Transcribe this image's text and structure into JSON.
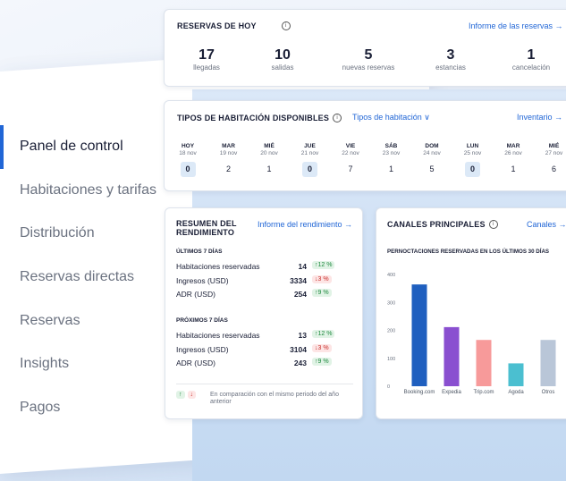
{
  "sidebar": {
    "items": [
      {
        "label": "Panel de control",
        "active": true
      },
      {
        "label": "Habitaciones y tarifas",
        "active": false
      },
      {
        "label": "Distribución",
        "active": false
      },
      {
        "label": "Reservas directas",
        "active": false
      },
      {
        "label": "Reservas",
        "active": false
      },
      {
        "label": "Insights",
        "active": false
      },
      {
        "label": "Pagos",
        "active": false
      }
    ]
  },
  "today": {
    "title": "RESERVAS DE HOY",
    "info_icon": "i",
    "link": "Informe de las reservas →",
    "stats": [
      {
        "value": "17",
        "label": "llegadas"
      },
      {
        "value": "10",
        "label": "salidas"
      },
      {
        "value": "5",
        "label": "nuevas reservas"
      },
      {
        "value": "3",
        "label": "estancias"
      },
      {
        "value": "1",
        "label": "cancelación"
      }
    ]
  },
  "rooms": {
    "title": "TIPOS DE HABITACIÓN DISPONIBLES",
    "info_icon": "i",
    "filter": "Tipos de habitación ∨",
    "link": "Inventario →",
    "days": [
      {
        "day": "HOY",
        "date": "18 nov",
        "value": "0",
        "zero": true
      },
      {
        "day": "MAR",
        "date": "19 nov",
        "value": "2",
        "zero": false
      },
      {
        "day": "MIÉ",
        "date": "20 nov",
        "value": "1",
        "zero": false
      },
      {
        "day": "JUE",
        "date": "21 nov",
        "value": "0",
        "zero": true
      },
      {
        "day": "VIE",
        "date": "22 nov",
        "value": "7",
        "zero": false
      },
      {
        "day": "SÁB",
        "date": "23 nov",
        "value": "1",
        "zero": false
      },
      {
        "day": "DOM",
        "date": "24 nov",
        "value": "5",
        "zero": false
      },
      {
        "day": "LUN",
        "date": "25 nov",
        "value": "0",
        "zero": true
      },
      {
        "day": "MAR",
        "date": "26 nov",
        "value": "1",
        "zero": false
      },
      {
        "day": "MIÉ",
        "date": "27 nov",
        "value": "6",
        "zero": false
      }
    ]
  },
  "performance": {
    "title": "RESUMEN DEL RENDIMIENTO",
    "link": "Informe del rendimiento →",
    "last7_label": "ÚLTIMOS 7 DÍAS",
    "last7": [
      {
        "label": "Habitaciones reservadas",
        "value": "14",
        "delta": "↑12 %",
        "dir": "up"
      },
      {
        "label": "Ingresos (USD)",
        "value": "3334",
        "delta": "↓3 %",
        "dir": "down"
      },
      {
        "label": "ADR (USD)",
        "value": "254",
        "delta": "↑9 %",
        "dir": "up"
      }
    ],
    "next7_label": "PRÓXIMOS 7 DÍAS",
    "next7": [
      {
        "label": "Habitaciones reservadas",
        "value": "13",
        "delta": "↑12 %",
        "dir": "up"
      },
      {
        "label": "Ingresos (USD)",
        "value": "3104",
        "delta": "↓3 %",
        "dir": "down"
      },
      {
        "label": "ADR (USD)",
        "value": "243",
        "delta": "↑9 %",
        "dir": "up"
      }
    ],
    "footnote": "En comparación con el mismo periodo del año anterior",
    "legend_up": "↑",
    "legend_down": "↓",
    "colors": {
      "up": "#1f8a3f",
      "down": "#c9302c"
    }
  },
  "channels": {
    "title": "CANALES PRINCIPALES",
    "info_icon": "i",
    "link": "Canales →",
    "chart_data": {
      "type": "bar",
      "title": "PERNOCTACIONES RESERVADAS EN LOS ÚLTIMOS 30 DÍAS",
      "categories": [
        "Booking.com",
        "Expedia",
        "Trip.com",
        "Agoda",
        "Otros"
      ],
      "values": [
        365,
        212,
        166,
        82,
        166
      ],
      "colors": [
        "#1f5fbf",
        "#8a4fd0",
        "#f79a9a",
        "#4bbfd0",
        "#b9c6d8"
      ],
      "yticks": [
        0,
        100,
        200,
        300,
        400
      ],
      "ylim": [
        0,
        420
      ],
      "grid": false
    }
  }
}
